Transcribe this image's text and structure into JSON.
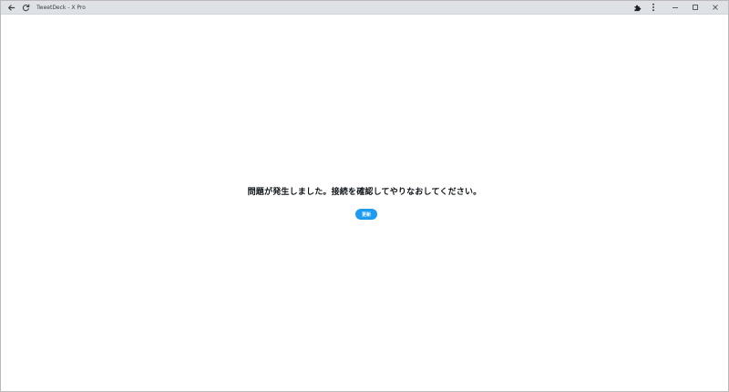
{
  "window": {
    "title": "TweetDeck - X Pro"
  },
  "icons": {
    "back": "arrow-left-icon",
    "reload": "reload-icon",
    "extensions": "puzzle-piece-icon",
    "menu": "kebab-menu-icon",
    "minimize": "minimize-icon",
    "maximize": "maximize-icon",
    "close": "close-icon"
  },
  "main": {
    "error_message": "問題が発生しました。接続を確認してやりなおしてください。",
    "refresh_label": "更新"
  },
  "colors": {
    "accent": "#1d9bf0",
    "text": "#0f1419",
    "titlebar": "#dee1e6"
  }
}
